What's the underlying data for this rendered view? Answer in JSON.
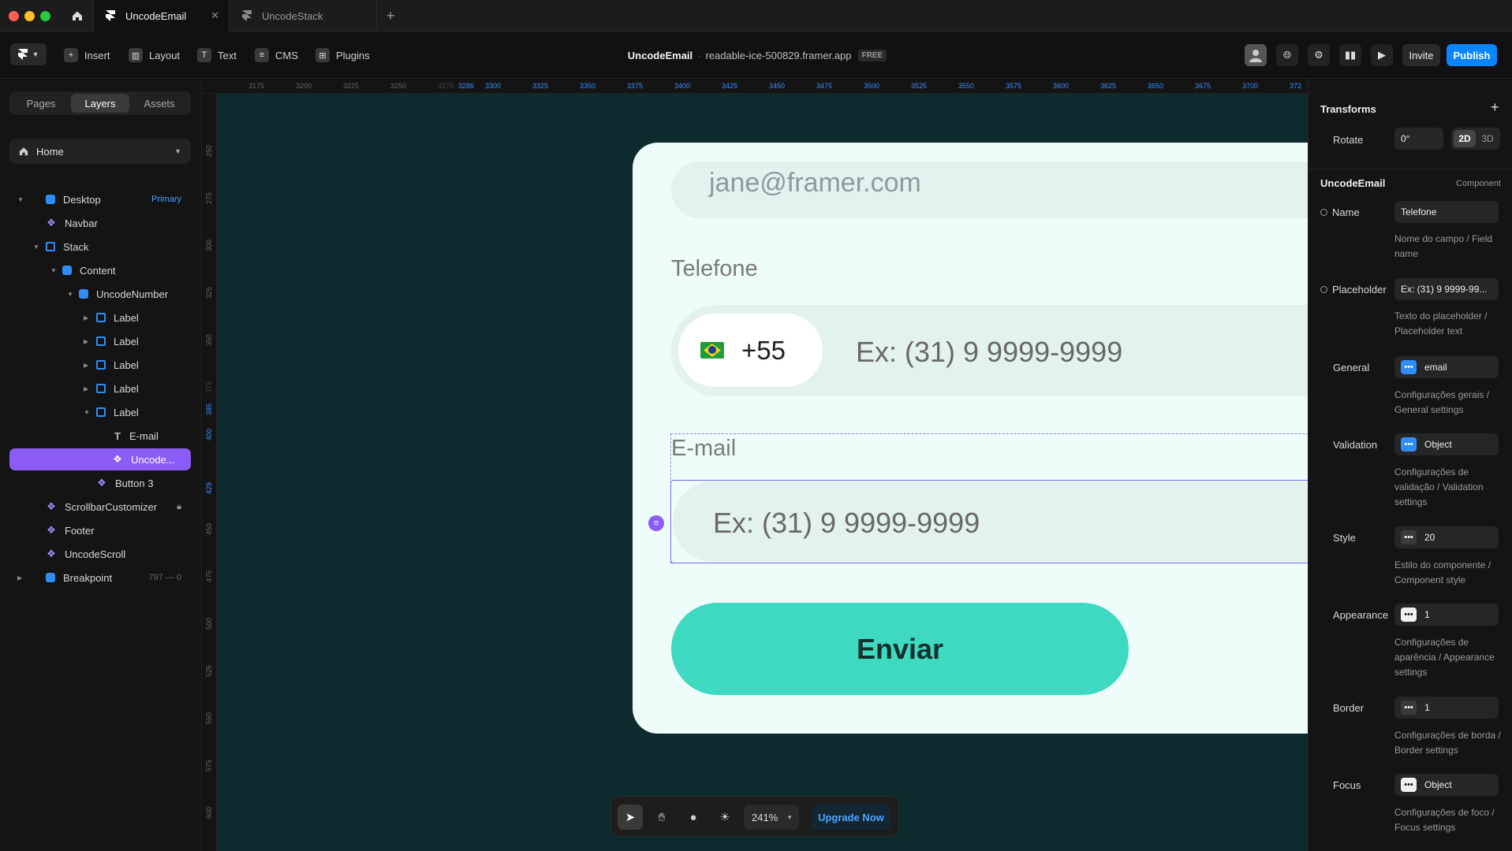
{
  "tabs": [
    {
      "label": "UncodeEmail",
      "active": true
    },
    {
      "label": "UncodeStack",
      "active": false
    }
  ],
  "toolbar": {
    "insert": "Insert",
    "layout": "Layout",
    "text": "Text",
    "cms": "CMS",
    "plugins": "Plugins",
    "project_title": "UncodeEmail",
    "domain": "readable-ice-500829.framer.app",
    "plan": "FREE",
    "invite": "Invite",
    "publish": "Publish"
  },
  "left": {
    "tabs": [
      "Pages",
      "Layers",
      "Assets"
    ],
    "page": "Home",
    "layers": [
      {
        "label": "Desktop",
        "badge": "Primary"
      },
      {
        "label": "Navbar"
      },
      {
        "label": "Stack"
      },
      {
        "label": "Content"
      },
      {
        "label": "UncodeNumber"
      },
      {
        "label": "Label"
      },
      {
        "label": "Label"
      },
      {
        "label": "Label"
      },
      {
        "label": "Label"
      },
      {
        "label": "Label"
      },
      {
        "label": "E-mail"
      },
      {
        "label": "Uncode..."
      },
      {
        "label": "Button 3"
      },
      {
        "label": "ScrollbarCustomizer"
      },
      {
        "label": "Footer"
      },
      {
        "label": "UncodeScroll"
      },
      {
        "label": "Breakpoint",
        "count": "797 — 0"
      }
    ]
  },
  "rulers": {
    "top": [
      "3175",
      "3200",
      "3225",
      "3250",
      "3275",
      "3286",
      "3300",
      "3325",
      "3350",
      "3375",
      "3400",
      "3425",
      "3450",
      "3475",
      "3500",
      "3525",
      "3550",
      "3575",
      "3600",
      "3625",
      "3650",
      "3675",
      "3700",
      "372"
    ],
    "left": [
      "250",
      "275",
      "300",
      "325",
      "350",
      "375",
      "385",
      "400",
      "429",
      "450",
      "475",
      "500",
      "525",
      "550",
      "575",
      "600"
    ]
  },
  "canvas": {
    "email_value": "jane@framer.com",
    "phone_label": "Telefone",
    "country_code": "+55",
    "phone_placeholder": "Ex: (31) 9 9999-9999",
    "email_label": "E-mail",
    "email_placeholder": "Ex: (31) 9 9999-9999",
    "submit": "Enviar"
  },
  "dock": {
    "zoom": "241%",
    "upgrade": "Upgrade Now"
  },
  "right": {
    "transforms": "Transforms",
    "rotate_label": "Rotate",
    "rotate_value": "0°",
    "mode_2d": "2D",
    "mode_3d": "3D",
    "component_name": "UncodeEmail",
    "component_tag": "Component",
    "props": [
      {
        "label": "Name",
        "value": "Telefone",
        "desc": "Nome do campo / Field name"
      },
      {
        "label": "Placeholder",
        "value": "Ex: (31) 9 9999-99...",
        "desc": "Texto do placeholder / Placeholder text"
      },
      {
        "label": "General",
        "value": "email",
        "desc": "Configurações gerais / General settings"
      },
      {
        "label": "Validation",
        "value": "Object",
        "desc": "Configurações de validação / Validation settings"
      },
      {
        "label": "Style",
        "value": "20",
        "desc": "Estilo do componente / Component style"
      },
      {
        "label": "Appearance",
        "value": "1",
        "desc": "Configurações de aparência / Appearance settings"
      },
      {
        "label": "Border",
        "value": "1",
        "desc": "Configurações de borda / Border settings"
      },
      {
        "label": "Focus",
        "value": "Object",
        "desc": "Configurações de foco / Focus settings"
      }
    ]
  }
}
